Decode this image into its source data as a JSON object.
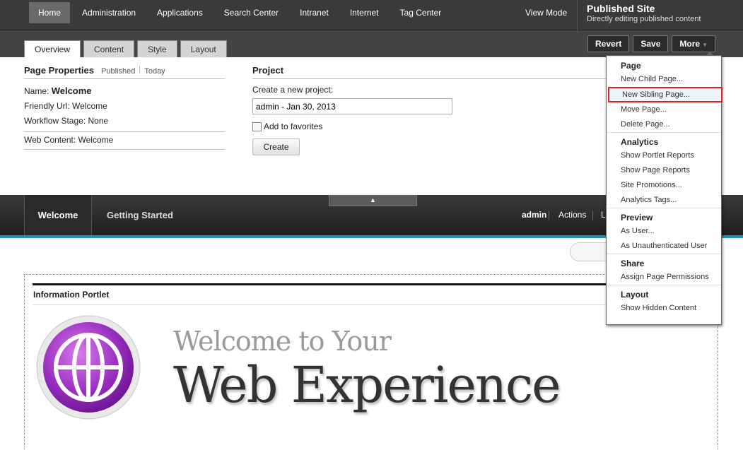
{
  "topnav": {
    "items": [
      {
        "label": "Home",
        "active": true
      },
      {
        "label": "Administration"
      },
      {
        "label": "Applications"
      },
      {
        "label": "Search Center"
      },
      {
        "label": "Intranet"
      },
      {
        "label": "Internet"
      },
      {
        "label": "Tag Center"
      }
    ],
    "view_mode": "View Mode",
    "site_title": "Published Site",
    "site_subtitle": "Directly editing published content"
  },
  "tabs": [
    "Overview",
    "Content",
    "Style",
    "Layout"
  ],
  "actions": {
    "revert": "Revert",
    "save": "Save",
    "more": "More"
  },
  "page_properties": {
    "title": "Page Properties",
    "status": "Published",
    "date": "Today",
    "name_label": "Name:",
    "name_value": "Welcome",
    "friendly_url": "Friendly Url:  Welcome",
    "workflow": "Workflow Stage:  None",
    "web_content": "Web Content:  Welcome"
  },
  "project": {
    "title": "Project",
    "create_label": "Create a new project:",
    "input_value": "admin - Jan 30, 2013",
    "favorites": "Add to favorites",
    "create_button": "Create"
  },
  "sitenav": {
    "welcome": "Welcome",
    "getting_started": "Getting Started",
    "user": "admin",
    "actions": "Actions",
    "truncated": "L",
    "toggle_icon": "▲"
  },
  "portlet": {
    "title": "Information Portlet",
    "welcome_line1": "Welcome to Your",
    "welcome_line2": "Web Experience"
  },
  "menu": {
    "sections": [
      {
        "title": "Page",
        "items": [
          "New Child Page...",
          "New Sibling Page...",
          "Move Page...",
          "Delete Page..."
        ]
      },
      {
        "title": "Analytics",
        "items": [
          "Show Portlet Reports",
          "Show Page Reports",
          "Site Promotions...",
          "Analytics Tags..."
        ]
      },
      {
        "title": "Preview",
        "items": [
          "As User...",
          "As Unauthenticated User"
        ]
      },
      {
        "title": "Share",
        "items": [
          "Assign Page Permissions"
        ]
      },
      {
        "title": "Layout",
        "items": [
          "Show Hidden Content"
        ]
      }
    ]
  }
}
